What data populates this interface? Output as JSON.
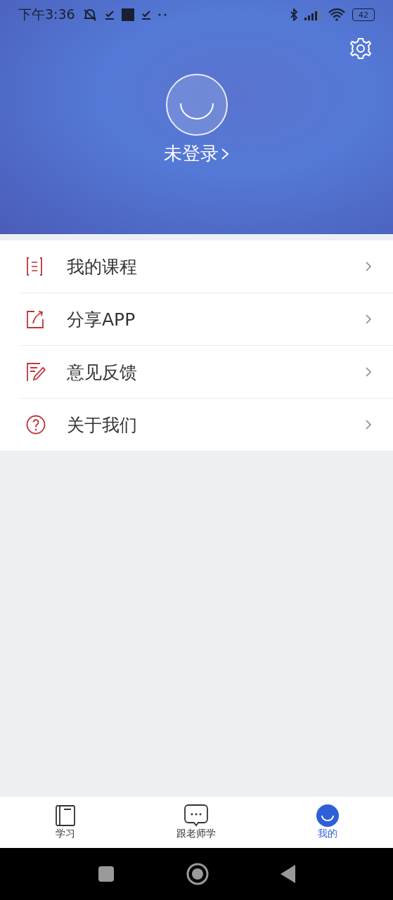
{
  "status_bar": {
    "time": "下午3:36",
    "battery": "42"
  },
  "profile": {
    "login_label": "未登录"
  },
  "menu": [
    {
      "kind": "course",
      "label": "我的课程"
    },
    {
      "kind": "share",
      "label": "分享APP"
    },
    {
      "kind": "feedback",
      "label": "意见反馈"
    },
    {
      "kind": "about",
      "label": "关于我们"
    }
  ],
  "tabs": [
    {
      "kind": "study",
      "label": "学习",
      "selected": false
    },
    {
      "kind": "teacher",
      "label": "跟老师学",
      "selected": false
    },
    {
      "kind": "mine",
      "label": "我的",
      "selected": true
    }
  ]
}
